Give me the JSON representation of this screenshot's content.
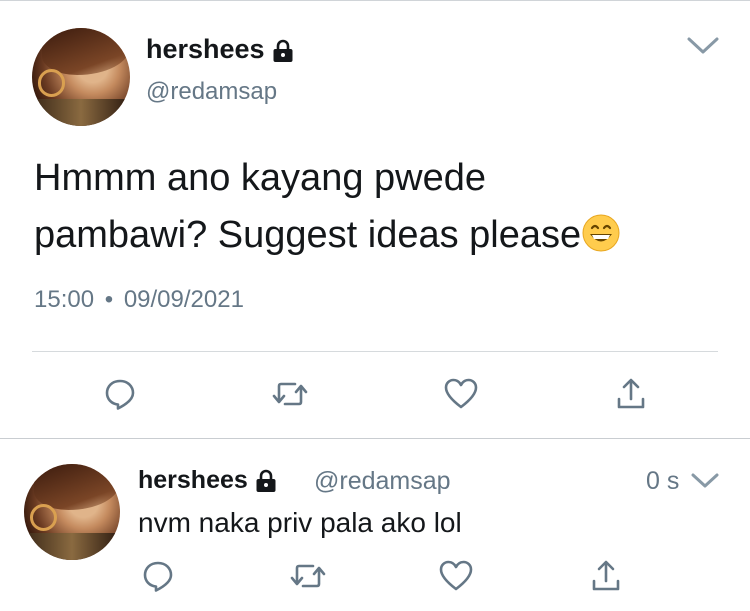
{
  "main_tweet": {
    "display_name": "hershees",
    "handle": "@redamsap",
    "text_line1": "Hmmm ano kayang pwede",
    "text_line2": "pambawi? Suggest ideas please",
    "emoji": "grinning-face-with-smiling-eyes",
    "time": "15:00",
    "separator": "•",
    "date": "09/09/2021"
  },
  "reply_tweet": {
    "display_name": "hershees",
    "handle": "@redamsap",
    "age": "0 s",
    "text": "nvm naka priv pala ako lol"
  },
  "icons": {
    "lock": "lock-icon",
    "chevron": "chevron-down-icon",
    "reply": "reply-icon",
    "retweet": "retweet-icon",
    "like": "heart-icon",
    "share": "share-icon"
  },
  "colors": {
    "icon_gray": "#657786",
    "text": "#14171a",
    "emoji_yellow": "#ffcc4d"
  }
}
